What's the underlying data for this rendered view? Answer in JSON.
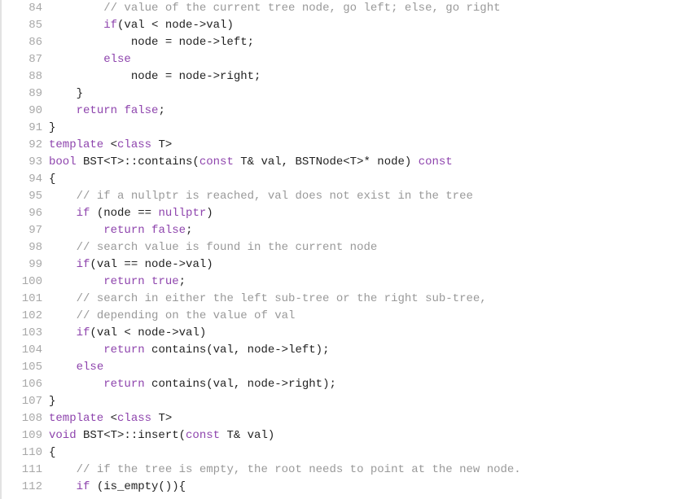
{
  "colors": {
    "keyword": "#8e44ad",
    "comment": "#999999",
    "plain": "#222222",
    "line_number": "#a8a8a8"
  },
  "lines": [
    {
      "n": "84",
      "tokens": [
        {
          "t": "        ",
          "k": "pl"
        },
        {
          "t": "// value of the current tree node, go left; else, go right",
          "k": "cm"
        }
      ]
    },
    {
      "n": "85",
      "tokens": [
        {
          "t": "        ",
          "k": "pl"
        },
        {
          "t": "if",
          "k": "kw"
        },
        {
          "t": "(val < node->val)",
          "k": "pl"
        }
      ]
    },
    {
      "n": "86",
      "tokens": [
        {
          "t": "            node = node->left;",
          "k": "pl"
        }
      ]
    },
    {
      "n": "87",
      "tokens": [
        {
          "t": "        ",
          "k": "pl"
        },
        {
          "t": "else",
          "k": "kw"
        }
      ]
    },
    {
      "n": "88",
      "tokens": [
        {
          "t": "            node = node->right;",
          "k": "pl"
        }
      ]
    },
    {
      "n": "89",
      "tokens": [
        {
          "t": "    }",
          "k": "pl"
        }
      ]
    },
    {
      "n": "90",
      "tokens": [
        {
          "t": "    ",
          "k": "pl"
        },
        {
          "t": "return",
          "k": "kw"
        },
        {
          "t": " ",
          "k": "pl"
        },
        {
          "t": "false",
          "k": "kw"
        },
        {
          "t": ";",
          "k": "pl"
        }
      ]
    },
    {
      "n": "91",
      "tokens": [
        {
          "t": "}",
          "k": "pl"
        }
      ]
    },
    {
      "n": "92",
      "tokens": [
        {
          "t": "template",
          "k": "kw"
        },
        {
          "t": " <",
          "k": "pl"
        },
        {
          "t": "class",
          "k": "kw"
        },
        {
          "t": " T>",
          "k": "pl"
        }
      ]
    },
    {
      "n": "93",
      "tokens": [
        {
          "t": "bool",
          "k": "kw"
        },
        {
          "t": " BST<T>::contains(",
          "k": "pl"
        },
        {
          "t": "const",
          "k": "kw"
        },
        {
          "t": " T& val, BSTNode<T>* node) ",
          "k": "pl"
        },
        {
          "t": "const",
          "k": "kw"
        }
      ]
    },
    {
      "n": "94",
      "tokens": [
        {
          "t": "{",
          "k": "pl"
        }
      ]
    },
    {
      "n": "95",
      "tokens": [
        {
          "t": "    ",
          "k": "pl"
        },
        {
          "t": "// if a nullptr is reached, val does not exist in the tree",
          "k": "cm"
        }
      ]
    },
    {
      "n": "96",
      "tokens": [
        {
          "t": "    ",
          "k": "pl"
        },
        {
          "t": "if",
          "k": "kw"
        },
        {
          "t": " (node == ",
          "k": "pl"
        },
        {
          "t": "nullptr",
          "k": "kw"
        },
        {
          "t": ")",
          "k": "pl"
        }
      ]
    },
    {
      "n": "97",
      "tokens": [
        {
          "t": "        ",
          "k": "pl"
        },
        {
          "t": "return",
          "k": "kw"
        },
        {
          "t": " ",
          "k": "pl"
        },
        {
          "t": "false",
          "k": "kw"
        },
        {
          "t": ";",
          "k": "pl"
        }
      ]
    },
    {
      "n": "98",
      "tokens": [
        {
          "t": "    ",
          "k": "pl"
        },
        {
          "t": "// search value is found in the current node",
          "k": "cm"
        }
      ]
    },
    {
      "n": "99",
      "tokens": [
        {
          "t": "    ",
          "k": "pl"
        },
        {
          "t": "if",
          "k": "kw"
        },
        {
          "t": "(val == node->val)",
          "k": "pl"
        }
      ]
    },
    {
      "n": "100",
      "tokens": [
        {
          "t": "        ",
          "k": "pl"
        },
        {
          "t": "return",
          "k": "kw"
        },
        {
          "t": " ",
          "k": "pl"
        },
        {
          "t": "true",
          "k": "kw"
        },
        {
          "t": ";",
          "k": "pl"
        }
      ]
    },
    {
      "n": "101",
      "tokens": [
        {
          "t": "    ",
          "k": "pl"
        },
        {
          "t": "// search in either the left sub-tree or the right sub-tree,",
          "k": "cm"
        }
      ]
    },
    {
      "n": "102",
      "tokens": [
        {
          "t": "    ",
          "k": "pl"
        },
        {
          "t": "// depending on the value of val",
          "k": "cm"
        }
      ]
    },
    {
      "n": "103",
      "tokens": [
        {
          "t": "    ",
          "k": "pl"
        },
        {
          "t": "if",
          "k": "kw"
        },
        {
          "t": "(val < node->val)",
          "k": "pl"
        }
      ]
    },
    {
      "n": "104",
      "tokens": [
        {
          "t": "        ",
          "k": "pl"
        },
        {
          "t": "return",
          "k": "kw"
        },
        {
          "t": " contains(val, node->left);",
          "k": "pl"
        }
      ]
    },
    {
      "n": "105",
      "tokens": [
        {
          "t": "    ",
          "k": "pl"
        },
        {
          "t": "else",
          "k": "kw"
        }
      ]
    },
    {
      "n": "106",
      "tokens": [
        {
          "t": "        ",
          "k": "pl"
        },
        {
          "t": "return",
          "k": "kw"
        },
        {
          "t": " contains(val, node->right);",
          "k": "pl"
        }
      ]
    },
    {
      "n": "107",
      "tokens": [
        {
          "t": "}",
          "k": "pl"
        }
      ]
    },
    {
      "n": "108",
      "tokens": [
        {
          "t": "template",
          "k": "kw"
        },
        {
          "t": " <",
          "k": "pl"
        },
        {
          "t": "class",
          "k": "kw"
        },
        {
          "t": " T>",
          "k": "pl"
        }
      ]
    },
    {
      "n": "109",
      "tokens": [
        {
          "t": "void",
          "k": "kw"
        },
        {
          "t": " BST<T>::insert(",
          "k": "pl"
        },
        {
          "t": "const",
          "k": "kw"
        },
        {
          "t": " T& val)",
          "k": "pl"
        }
      ]
    },
    {
      "n": "110",
      "tokens": [
        {
          "t": "{",
          "k": "pl"
        }
      ]
    },
    {
      "n": "111",
      "tokens": [
        {
          "t": "    ",
          "k": "pl"
        },
        {
          "t": "// if the tree is empty, the root needs to point at the new node.",
          "k": "cm"
        }
      ]
    },
    {
      "n": "112",
      "tokens": [
        {
          "t": "    ",
          "k": "pl"
        },
        {
          "t": "if",
          "k": "kw"
        },
        {
          "t": " (is_empty()){",
          "k": "pl"
        }
      ]
    }
  ]
}
